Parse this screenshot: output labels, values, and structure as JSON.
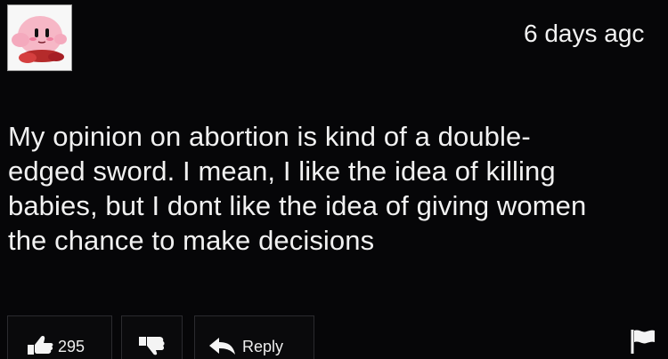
{
  "post": {
    "timestamp": "6 days agc",
    "body_lines": [
      "My opinion on abortion is kind of a double-",
      "edged sword. I mean, I like the idea of killing",
      "babies, but I dont like the idea of giving women",
      "the chance to make decisions"
    ]
  },
  "actions": {
    "like_count": "295",
    "reply_label": "Reply"
  },
  "icons": {
    "avatar": "kirby-avatar",
    "like": "thumbs-up-icon",
    "dislike": "thumbs-down-icon",
    "reply": "reply-arrow-icon",
    "flag": "flag-icon"
  },
  "colors": {
    "background": "#060608",
    "text": "#f1f1f1",
    "button_border": "#2b2b2f",
    "avatar_pink": "#f6b7c6",
    "avatar_red": "#b52b2b"
  }
}
